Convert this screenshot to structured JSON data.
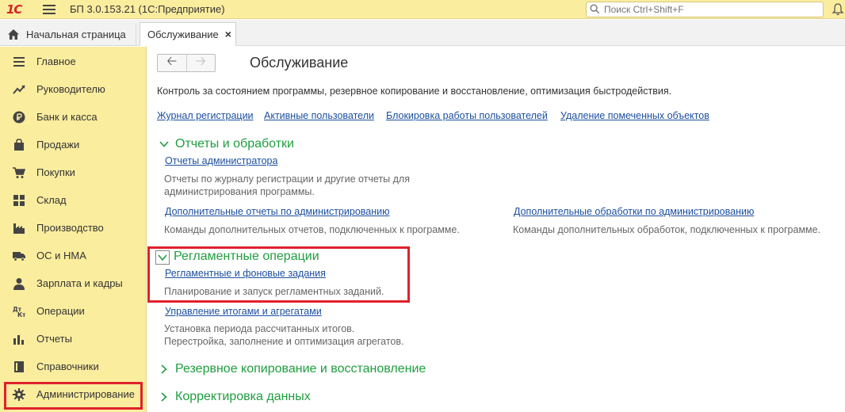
{
  "app": {
    "logo": "1С",
    "title": "БП 3.0.153.21  (1С:Предприятие)",
    "search_placeholder": "Поиск Ctrl+Shift+F"
  },
  "tabs": {
    "home": "Начальная страница",
    "active": "Обслуживание",
    "close": "×"
  },
  "sidebar": {
    "items": [
      {
        "label": "Главное",
        "icon": "menu-lines-icon"
      },
      {
        "label": "Руководителю",
        "icon": "trend-chart-icon"
      },
      {
        "label": "Банк и касса",
        "icon": "ruble-coin-icon"
      },
      {
        "label": "Продажи",
        "icon": "shopping-bag-icon"
      },
      {
        "label": "Покупки",
        "icon": "shopping-cart-icon"
      },
      {
        "label": "Склад",
        "icon": "warehouse-icon"
      },
      {
        "label": "Производство",
        "icon": "factory-icon"
      },
      {
        "label": "ОС и НМА",
        "icon": "truck-icon"
      },
      {
        "label": "Зарплата и кадры",
        "icon": "person-icon"
      },
      {
        "label": "Операции",
        "icon": "debit-credit-icon"
      },
      {
        "label": "Отчеты",
        "icon": "bar-chart-icon"
      },
      {
        "label": "Справочники",
        "icon": "book-icon"
      },
      {
        "label": "Администрирование",
        "icon": "gear-icon"
      }
    ]
  },
  "main": {
    "title": "Обслуживание",
    "description": "Контроль за состоянием программы, резервное копирование и восстановление, оптимизация быстродействия.",
    "top_links": [
      "Журнал регистрации",
      "Активные пользователи",
      "Блокировка работы пользователей",
      "Удаление помеченных объектов"
    ],
    "sections": {
      "reports": {
        "title": "Отчеты и обработки",
        "admin_reports_link": "Отчеты администратора",
        "admin_reports_note_1": "Отчеты по журналу регистрации и другие отчеты для",
        "admin_reports_note_2": "администрирования программы.",
        "extra_reports_link": "Дополнительные отчеты по администрированию",
        "extra_reports_note": "Команды дополнительных отчетов, подключенных к программе.",
        "extra_processing_link": "Дополнительные обработки по администрированию",
        "extra_processing_note": "Команды дополнительных обработок, подключенных к программе."
      },
      "routine": {
        "title": "Регламентные операции",
        "jobs_link": "Регламентные и фоновые задания",
        "jobs_note": "Планирование и запуск регламентных заданий.",
        "totals_link": "Управление итогами и агрегатами",
        "totals_note_1": "Установка периода рассчитанных итогов.",
        "totals_note_2": "Перестройка, заполнение и оптимизация агрегатов."
      },
      "backup": {
        "title": "Резервное копирование и восстановление"
      },
      "correction": {
        "title": "Корректировка данных"
      }
    }
  },
  "colors": {
    "accent_yellow": "#fbed9e",
    "section_green": "#1f9e3f",
    "link_blue": "#1c4fa0",
    "highlight_red": "#e0202c"
  }
}
